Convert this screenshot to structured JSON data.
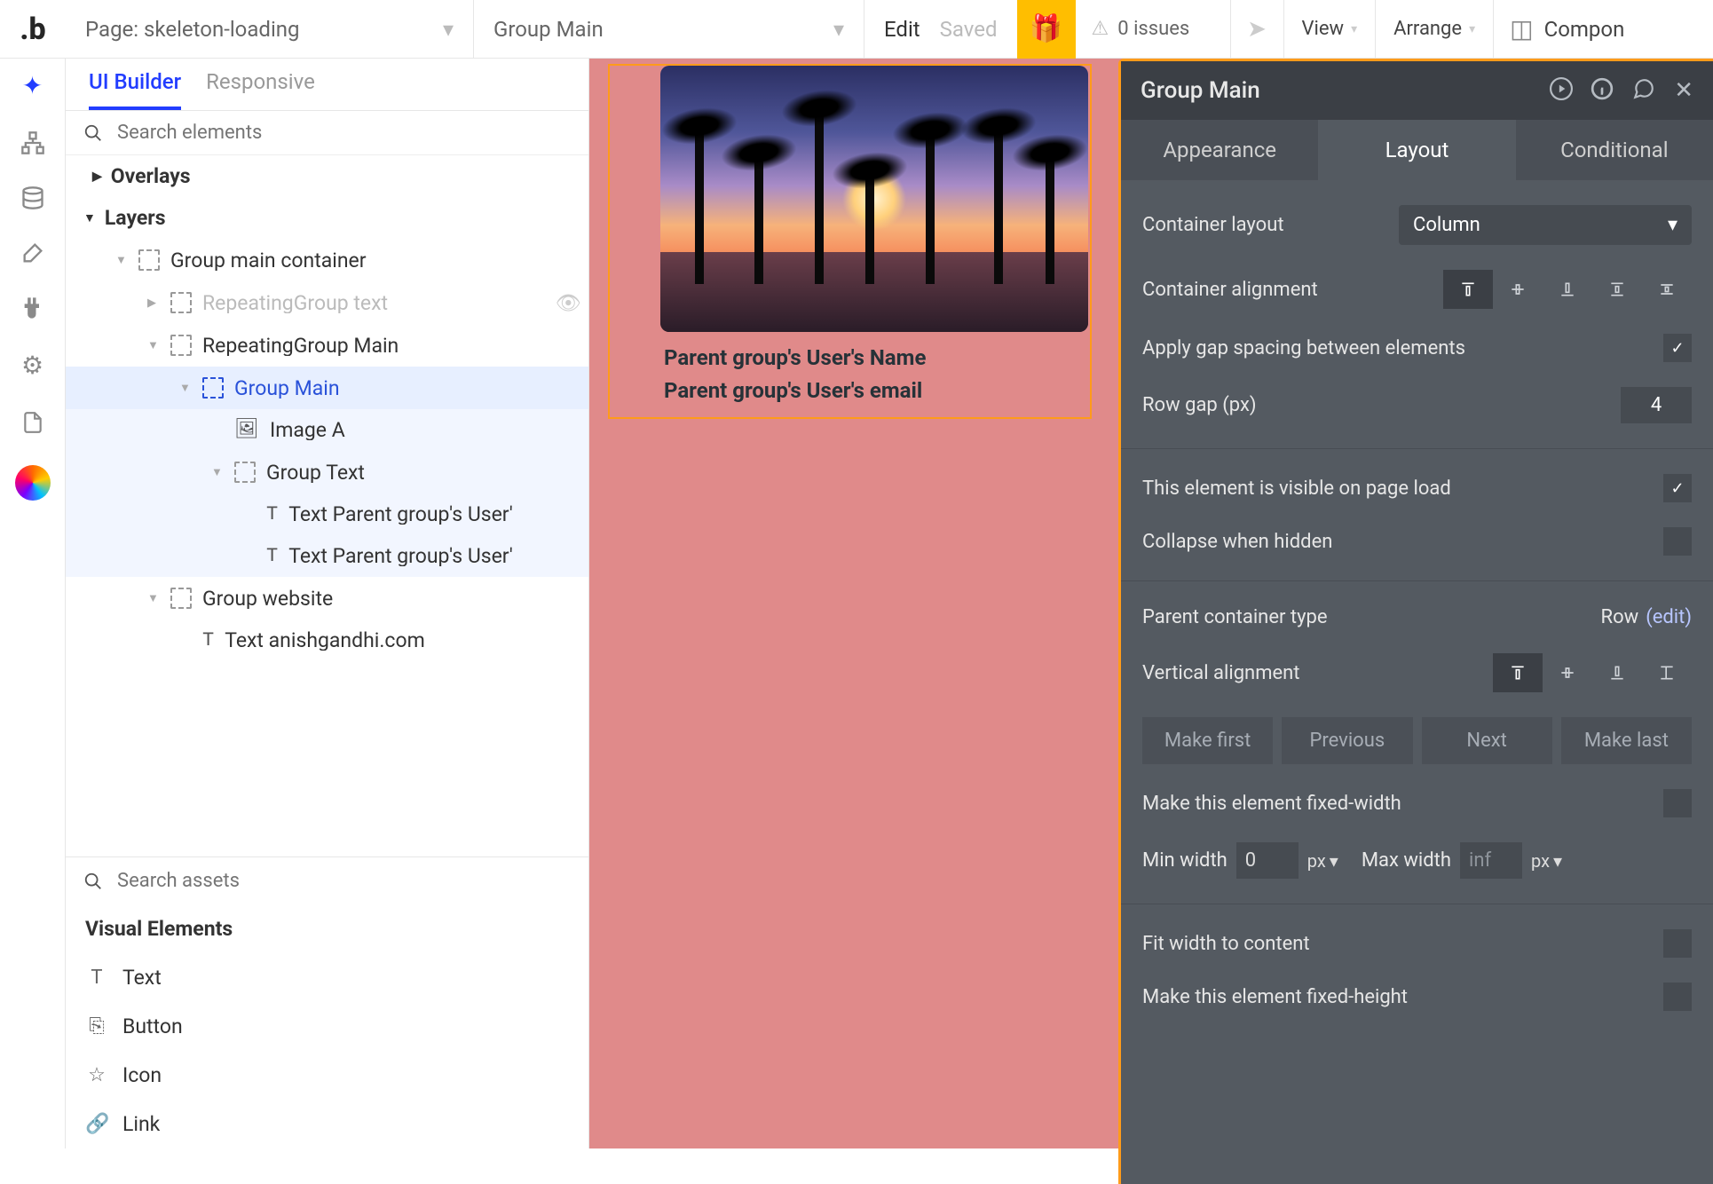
{
  "topbar": {
    "page_label_prefix": "Page: ",
    "page_name": "skeleton-loading",
    "element_name": "Group Main",
    "edit": "Edit",
    "saved": "Saved",
    "issues_count": "0 issues",
    "view": "View",
    "arrange": "Arrange",
    "components": "Compon"
  },
  "sidetabs": {
    "ui_builder": "UI Builder",
    "responsive": "Responsive"
  },
  "search": {
    "elements_placeholder": "Search elements",
    "assets_placeholder": "Search assets"
  },
  "tree": {
    "overlays": "Overlays",
    "layers": "Layers",
    "items": [
      {
        "label": "Group main container",
        "indent": 0,
        "icon": "group",
        "tri": "down"
      },
      {
        "label": "RepeatingGroup text",
        "indent": 1,
        "icon": "group",
        "tri": "right",
        "muted": true,
        "hidden": true
      },
      {
        "label": "RepeatingGroup Main",
        "indent": 1,
        "icon": "group",
        "tri": "down"
      },
      {
        "label": "Group Main",
        "indent": 2,
        "icon": "group",
        "tri": "down",
        "selected": true
      },
      {
        "label": "Image A",
        "indent": 3,
        "icon": "image",
        "childsel": true
      },
      {
        "label": "Group Text",
        "indent": 3,
        "icon": "group",
        "tri": "down",
        "childsel": true
      },
      {
        "label": "Text Parent group's User'",
        "indent": 4,
        "icon": "text",
        "childsel": true
      },
      {
        "label": "Text Parent group's User'",
        "indent": 4,
        "icon": "text",
        "childsel": true
      },
      {
        "label": "Group website",
        "indent": 1,
        "icon": "group",
        "tri": "down"
      },
      {
        "label": "Text anishgandhi.com",
        "indent": 2,
        "icon": "text"
      }
    ]
  },
  "visual_elements": {
    "header": "Visual Elements",
    "items": [
      {
        "label": "Text",
        "icon": "T"
      },
      {
        "label": "Button",
        "icon": "⎘"
      },
      {
        "label": "Icon",
        "icon": "☆"
      },
      {
        "label": "Link",
        "icon": "🔗"
      }
    ]
  },
  "canvas": {
    "name_line": "Parent group's User's Name",
    "email_line": "Parent group's User's email"
  },
  "inspector": {
    "title": "Group Main",
    "tabs": {
      "appearance": "Appearance",
      "layout": "Layout",
      "conditional": "Conditional"
    },
    "container_layout_label": "Container layout",
    "container_layout_value": "Column",
    "container_alignment_label": "Container alignment",
    "apply_gap_label": "Apply gap spacing between elements",
    "row_gap_label": "Row gap (px)",
    "row_gap_value": "4",
    "visible_label": "This element is visible on page load",
    "collapse_label": "Collapse when hidden",
    "parent_type_label": "Parent container type",
    "parent_type_value": "Row",
    "parent_type_edit": "(edit)",
    "valign_label": "Vertical alignment",
    "position_buttons": {
      "first": "Make first",
      "prev": "Previous",
      "next": "Next",
      "last": "Make last"
    },
    "fixed_width_label": "Make this element fixed-width",
    "min_width_label": "Min width",
    "min_width_value": "0",
    "max_width_label": "Max width",
    "max_width_value": "inf",
    "unit1": "px",
    "unit2": "px",
    "fit_width_label": "Fit width to content",
    "fixed_height_label": "Make this element fixed-height"
  }
}
